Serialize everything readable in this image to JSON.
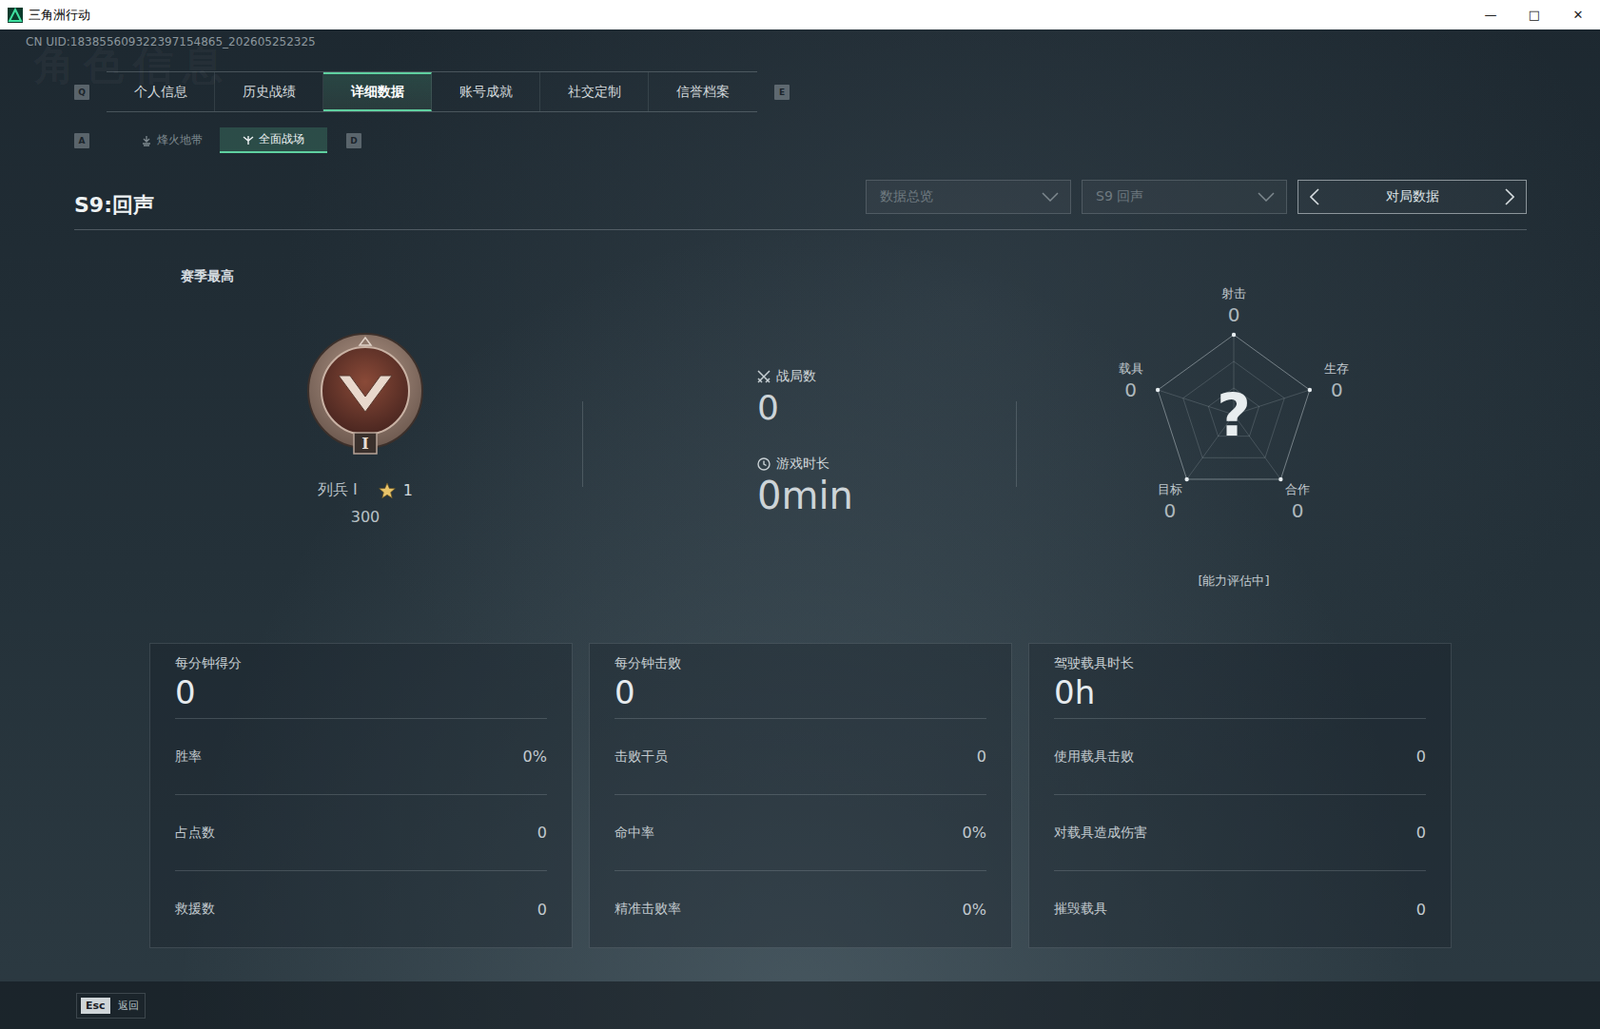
{
  "window": {
    "title": "三角洲行动",
    "controls": [
      "—",
      "□",
      "✕"
    ]
  },
  "uid": "CN UID:183855609322397154865_202605252325",
  "watermark": "角色信息",
  "tabs": {
    "prev_key": "Q",
    "next_key": "E",
    "items": [
      {
        "label": "个人信息",
        "selected": false
      },
      {
        "label": "历史战绩",
        "selected": false
      },
      {
        "label": "详细数据",
        "selected": true
      },
      {
        "label": "账号成就",
        "selected": false
      },
      {
        "label": "社交定制",
        "selected": false
      },
      {
        "label": "信誉档案",
        "selected": false
      }
    ]
  },
  "mode_tabs": {
    "prev_key": "A",
    "next_key": "D",
    "items": [
      {
        "label": "烽火地带",
        "selected": false,
        "kind": "extraction"
      },
      {
        "label": "全面战场",
        "selected": true,
        "kind": "warfare"
      }
    ]
  },
  "season_title": "S9:回声",
  "filters": [
    {
      "value": "数据总览"
    },
    {
      "value": "S9 回声"
    }
  ],
  "stepper": {
    "label": "对局数据"
  },
  "rank": {
    "heading": "赛季最高",
    "emblem_numeral": "I",
    "name": "列兵 I",
    "star_count": "1",
    "points": "300"
  },
  "summary": [
    {
      "label": "战局数",
      "value": "0",
      "kind": "matches"
    },
    {
      "label": "游戏时长",
      "value": "0min",
      "kind": "duration"
    }
  ],
  "radar": {
    "axes": [
      {
        "label": "射击",
        "value": "0"
      },
      {
        "label": "生存",
        "value": "0"
      },
      {
        "label": "合作",
        "value": "0"
      },
      {
        "label": "目标",
        "value": "0"
      },
      {
        "label": "载具",
        "value": "0"
      }
    ],
    "center": "?",
    "status": "[能力评估中]"
  },
  "cards": [
    {
      "title": "每分钟得分",
      "value": "0",
      "rows": [
        {
          "label": "胜率",
          "value": "0%"
        },
        {
          "label": "占点数",
          "value": "0"
        },
        {
          "label": "救援数",
          "value": "0"
        }
      ]
    },
    {
      "title": "每分钟击败",
      "value": "0",
      "rows": [
        {
          "label": "击败干员",
          "value": "0"
        },
        {
          "label": "命中率",
          "value": "0%"
        },
        {
          "label": "精准击败率",
          "value": "0%"
        }
      ]
    },
    {
      "title": "驾驶载具时长",
      "value": "0h",
      "rows": [
        {
          "label": "使用载具击败",
          "value": "0"
        },
        {
          "label": "对载具造成伤害",
          "value": "0"
        },
        {
          "label": "摧毁载具",
          "value": "0"
        }
      ]
    }
  ],
  "footer": {
    "key": "Esc",
    "label": "返回"
  }
}
